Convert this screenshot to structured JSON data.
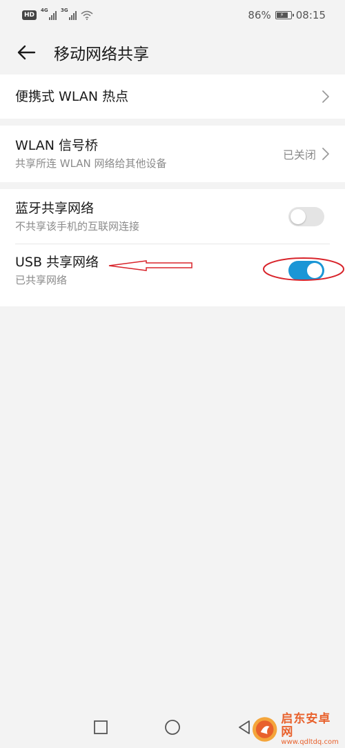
{
  "status_bar": {
    "hd_badge": "HD",
    "signal_1_net": "4G",
    "signal_2_net": "3G",
    "battery_percent": "86%",
    "battery_level": 0.86,
    "time": "08:15"
  },
  "header": {
    "title": "移动网络共享"
  },
  "hotspot": {
    "title": "便携式 WLAN 热点"
  },
  "bridge": {
    "title": "WLAN 信号桥",
    "subtitle": "共享所连 WLAN 网络给其他设备",
    "status": "已关闭"
  },
  "bluetooth": {
    "title": "蓝牙共享网络",
    "subtitle": "不共享该手机的互联网连接",
    "enabled": false
  },
  "usb": {
    "title": "USB 共享网络",
    "subtitle": "已共享网络",
    "enabled": true
  },
  "watermark": {
    "name": "启东安卓网",
    "url": "www.qdltdq.com"
  },
  "colors": {
    "accent": "#1a96d6",
    "annotation": "#d8232a",
    "watermark": "#e8612c"
  }
}
